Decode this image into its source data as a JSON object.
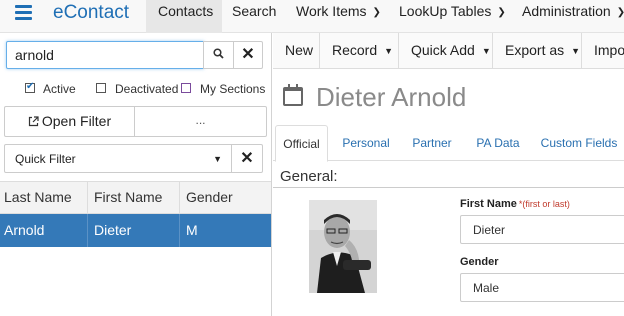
{
  "app": {
    "brand": "eContact"
  },
  "nav": {
    "items": [
      {
        "label": "Contacts",
        "active": true,
        "dropdown": false
      },
      {
        "label": "Search",
        "active": false,
        "dropdown": false
      },
      {
        "label": "Work Items",
        "active": false,
        "dropdown": true
      },
      {
        "label": "LookUp Tables",
        "active": false,
        "dropdown": true
      },
      {
        "label": "Administration",
        "active": false,
        "dropdown": true
      }
    ]
  },
  "sidebar": {
    "search": {
      "value": "arnold"
    },
    "filters": [
      {
        "label": "Active",
        "checked": true
      },
      {
        "label": "Deactivated",
        "checked": false
      },
      {
        "label": "My Sections",
        "checked": false
      }
    ],
    "open_filter_label": "Open Filter",
    "more_label": "...",
    "quick_filter": {
      "selected": "Quick Filter"
    },
    "grid": {
      "columns": [
        "Last Name",
        "First Name",
        "Gender"
      ],
      "rows": [
        [
          "Arnold",
          "Dieter",
          "M"
        ]
      ]
    }
  },
  "toolbar": {
    "new_label": "New",
    "record_label": "Record",
    "quick_add_label": "Quick Add",
    "export_label": "Export as",
    "import_label": "Impor"
  },
  "contact": {
    "name": "Dieter Arnold"
  },
  "tabs": [
    "Official",
    "Personal",
    "Partner",
    "PA Data",
    "Custom Fields"
  ],
  "form": {
    "section_title": "General:",
    "first_name_label": "First Name",
    "first_name_hint": "*(first or last)",
    "first_name_value": "Dieter",
    "gender_label": "Gender",
    "gender_value": "Male"
  },
  "colors": {
    "brand": "#1f6fb5",
    "selection": "#3479b8",
    "hint": "#c0392b"
  }
}
